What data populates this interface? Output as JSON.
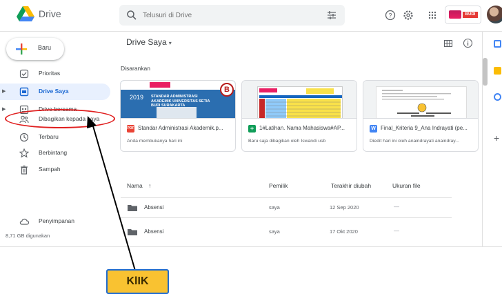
{
  "header": {
    "brand": "Drive",
    "search_placeholder": "Telusuri di Drive",
    "account_logo_text": "BUDI"
  },
  "sidebar": {
    "new_label": "Baru",
    "items": [
      {
        "label": "Prioritas",
        "icon": "priority-icon"
      },
      {
        "label": "Drive Saya",
        "icon": "my-drive-icon",
        "active": true
      },
      {
        "label": "Drive bersama",
        "icon": "shared-drives-icon"
      },
      {
        "label": "Dibagikan kepada saya",
        "icon": "shared-with-me-icon"
      },
      {
        "label": "Terbaru",
        "icon": "clock-icon"
      },
      {
        "label": "Berbintang",
        "icon": "star-icon"
      },
      {
        "label": "Sampah",
        "icon": "trash-icon"
      },
      {
        "label": "Penyimpanan",
        "icon": "cloud-icon"
      }
    ],
    "storage_used": "8,71 GB digunakan"
  },
  "main": {
    "title": "Drive Saya",
    "suggested_label": "Disarankan",
    "cards": [
      {
        "title": "Standar Administrasi Akademik.p...",
        "subtitle": "Anda membukanya hari ini",
        "file_badge": "PDF",
        "thumb_year": "2019",
        "thumb_text": "STANDAR ADMINISTRASI AKADEMIK UNIVERSITAS SETIA BUDI SURAKARTA",
        "thumb_logo": "B"
      },
      {
        "title": "1#Latihan. Nama Mahasiswa#AP...",
        "subtitle": "Baru saja dibagikan oleh Iswandi usb",
        "file_badge": "+"
      },
      {
        "title": "Final_Kriteria 9_Ana Indrayati (pe...",
        "subtitle": "Diedit hari ini oleh anaindrayati anaindray...",
        "file_badge": "W"
      }
    ],
    "columns": {
      "name": "Nama",
      "sort_arrow": "↑",
      "owner": "Pemilik",
      "modified": "Terakhir diubah",
      "size": "Ukuran file"
    },
    "rows": [
      {
        "name": "Absensi",
        "owner": "saya",
        "modified": "12 Sep 2020",
        "size": "—"
      },
      {
        "name": "Absensi",
        "owner": "saya",
        "modified": "17 Okt 2020",
        "size": "—"
      }
    ]
  },
  "annotation": {
    "label": "KlIK",
    "highlight_color": "#e02020",
    "label_bg": "#f9c231",
    "label_border": "#1e6bd1"
  },
  "colors": {
    "accent": "#1967d2",
    "active_bg": "#e8f0fe"
  }
}
